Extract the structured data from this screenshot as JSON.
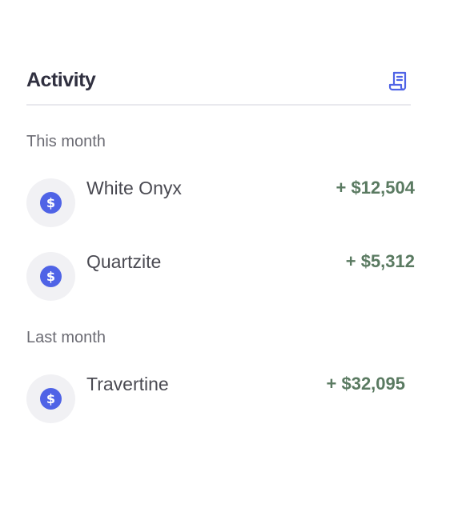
{
  "header": {
    "title": "Activity",
    "receipt_icon": "receipt-icon"
  },
  "sections": [
    {
      "label": "This month",
      "items": [
        {
          "name": "White Onyx",
          "amount": "+ $12,504",
          "icon": "dollar-circle-icon"
        },
        {
          "name": "Quartzite",
          "amount": "+ $5,312",
          "icon": "dollar-circle-icon"
        }
      ]
    },
    {
      "label": "Last month",
      "items": [
        {
          "name": "Travertine",
          "amount": "+ $32,095",
          "icon": "dollar-circle-icon"
        }
      ]
    }
  ],
  "colors": {
    "accent": "#4f63e6",
    "amount": "#5a7a61",
    "title": "#303040",
    "muted": "#6b6b73",
    "avatar_bg": "#f1f1f4"
  }
}
